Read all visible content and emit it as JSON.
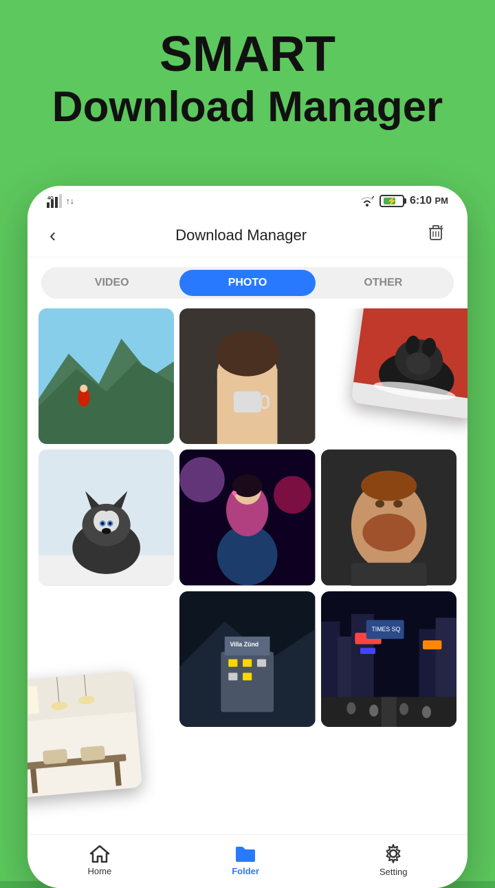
{
  "background_color": "#5dc85d",
  "hero": {
    "line1": "SMART",
    "line2": "Download Manager"
  },
  "status_bar": {
    "signal": "▲",
    "network": "4G",
    "wifi": "▼",
    "time": "6:10",
    "am_pm": "PM"
  },
  "header": {
    "title": "Download Manager",
    "back_label": "‹",
    "trash_label": "🗑"
  },
  "tabs": [
    {
      "id": "video",
      "label": "VIDEO",
      "active": false
    },
    {
      "id": "photo",
      "label": "PHOTO",
      "active": true
    },
    {
      "id": "other",
      "label": "OTHER",
      "active": false
    }
  ],
  "photos": [
    {
      "id": "p1",
      "scene": "mountain",
      "description": "Mountain landscape with person in red"
    },
    {
      "id": "p2",
      "scene": "portrait",
      "description": "Woman with coffee mug portrait"
    },
    {
      "id": "p3",
      "scene": "husky",
      "description": "Husky dog in snow (row 2)"
    },
    {
      "id": "p4",
      "scene": "girl-neon",
      "description": "Girl with neon lights"
    },
    {
      "id": "p5",
      "scene": "man-beard",
      "description": "Bearded man portrait"
    },
    {
      "id": "p6",
      "scene": "building",
      "description": "Mountain building at night"
    },
    {
      "id": "p7",
      "scene": "city",
      "description": "City street at night Times Square"
    }
  ],
  "floating_photos": [
    {
      "id": "fp1",
      "scene": "dog-snow",
      "description": "Dog in red/snow scene top right"
    },
    {
      "id": "fp2",
      "scene": "interior",
      "description": "Interior room bottom left"
    }
  ],
  "bottom_nav": [
    {
      "id": "home",
      "label": "Home",
      "icon": "home",
      "active": false
    },
    {
      "id": "folder",
      "label": "Folder",
      "icon": "folder",
      "active": true
    },
    {
      "id": "setting",
      "label": "Setting",
      "icon": "setting",
      "active": false
    }
  ]
}
